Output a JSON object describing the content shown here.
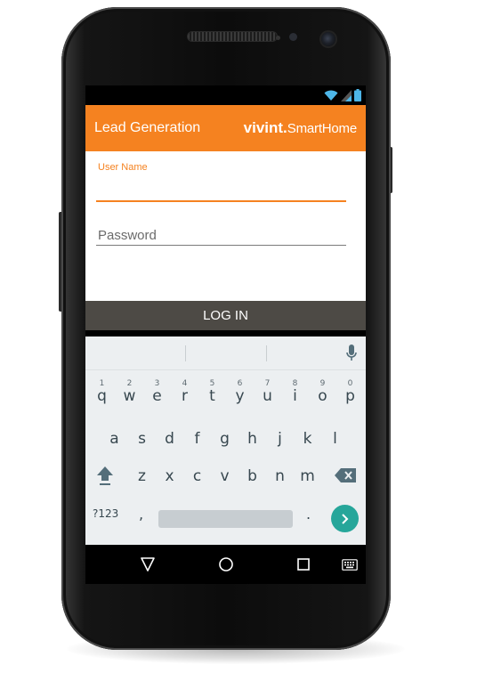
{
  "device": {
    "name": "android-phone"
  },
  "status_bar": {
    "icons": [
      "wifi-icon",
      "signal-icon",
      "battery-icon"
    ]
  },
  "app_bar": {
    "title": "Lead Generation",
    "logo_bold": "vivint.",
    "logo_regular": "SmartHome",
    "color": "#f58220"
  },
  "form": {
    "username_label": "User Name",
    "username_value": "",
    "password_placeholder": "Password",
    "password_value": ""
  },
  "login_button": {
    "label": "LOG IN",
    "color": "#4d4a45"
  },
  "keyboard": {
    "rows": [
      [
        {
          "k": "q",
          "h": "1"
        },
        {
          "k": "w",
          "h": "2"
        },
        {
          "k": "e",
          "h": "3"
        },
        {
          "k": "r",
          "h": "4"
        },
        {
          "k": "t",
          "h": "5"
        },
        {
          "k": "y",
          "h": "6"
        },
        {
          "k": "u",
          "h": "7"
        },
        {
          "k": "i",
          "h": "8"
        },
        {
          "k": "o",
          "h": "9"
        },
        {
          "k": "p",
          "h": "0"
        }
      ],
      [
        {
          "k": "a"
        },
        {
          "k": "s"
        },
        {
          "k": "d"
        },
        {
          "k": "f"
        },
        {
          "k": "g"
        },
        {
          "k": "h"
        },
        {
          "k": "j"
        },
        {
          "k": "k"
        },
        {
          "k": "l"
        }
      ],
      [
        {
          "k": "z"
        },
        {
          "k": "x"
        },
        {
          "k": "c"
        },
        {
          "k": "v"
        },
        {
          "k": "b"
        },
        {
          "k": "n"
        },
        {
          "k": "m"
        }
      ]
    ],
    "symbols_key": "?123",
    "comma_key": ",",
    "period_key": ".",
    "enter_color": "#26a69a"
  },
  "nav_bar": {
    "icons": [
      "back-icon",
      "home-icon",
      "recents-icon",
      "keyboard-switch-icon"
    ]
  }
}
